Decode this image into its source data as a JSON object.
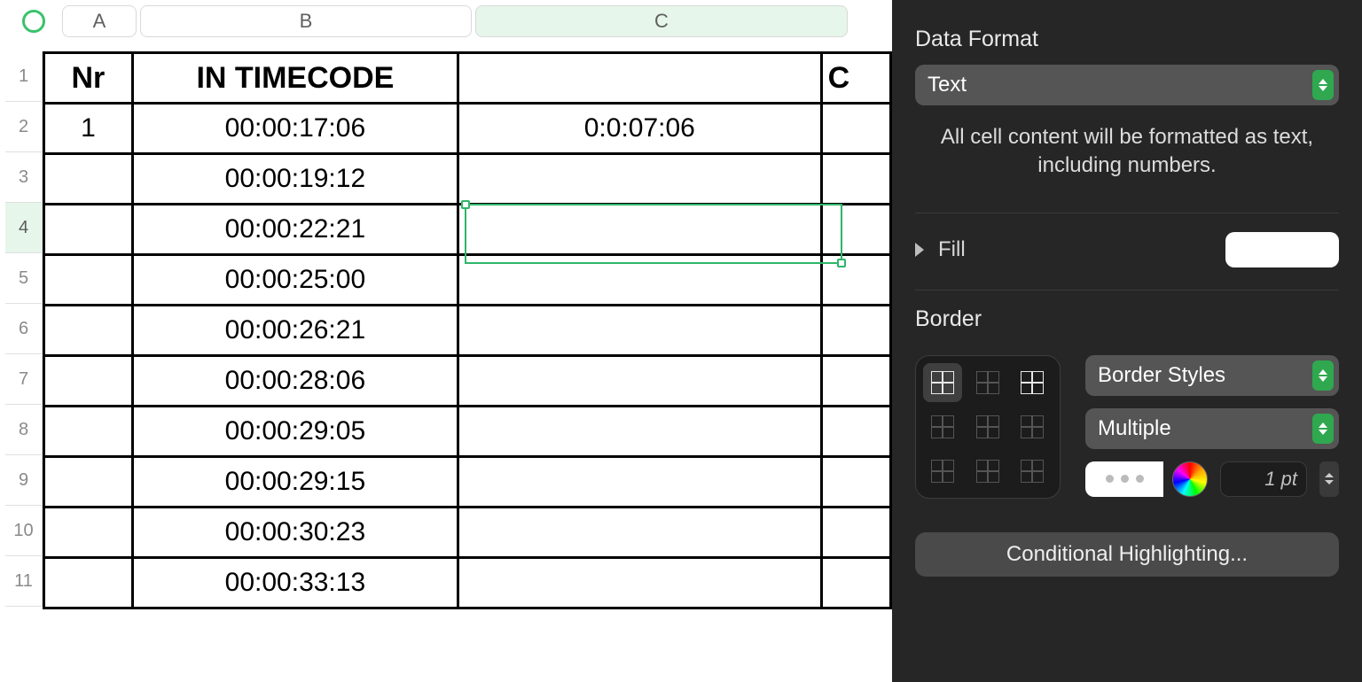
{
  "columns": {
    "A": "A",
    "B": "B",
    "C": "C"
  },
  "row_numbers": [
    "1",
    "2",
    "3",
    "4",
    "5",
    "6",
    "7",
    "8",
    "9",
    "10",
    "11"
  ],
  "selected_row": "4",
  "table": {
    "header": {
      "A": "Nr",
      "B": "IN TIMECODE",
      "D_partial": "C"
    },
    "rows": [
      {
        "A": "1",
        "B": "00:00:17:06",
        "C": "0:0:07:06"
      },
      {
        "A": "",
        "B": "00:00:19:12",
        "C": ""
      },
      {
        "A": "",
        "B": "00:00:22:21",
        "C": ""
      },
      {
        "A": "",
        "B": "00:00:25:00",
        "C": ""
      },
      {
        "A": "",
        "B": "00:00:26:21",
        "C": ""
      },
      {
        "A": "",
        "B": "00:00:28:06",
        "C": ""
      },
      {
        "A": "",
        "B": "00:00:29:05",
        "C": ""
      },
      {
        "A": "",
        "B": "00:00:29:15",
        "C": ""
      },
      {
        "A": "",
        "B": "00:00:30:23",
        "C": ""
      },
      {
        "A": "",
        "B": "00:00:33:13",
        "C": ""
      }
    ]
  },
  "inspector": {
    "data_format_title": "Data Format",
    "data_format_value": "Text",
    "data_format_hint": "All cell content will be formatted as text, including numbers.",
    "fill_label": "Fill",
    "border_title": "Border",
    "border_styles_label": "Border Styles",
    "border_line_value": "Multiple",
    "border_width": "1 pt",
    "conditional_btn": "Conditional Highlighting..."
  }
}
